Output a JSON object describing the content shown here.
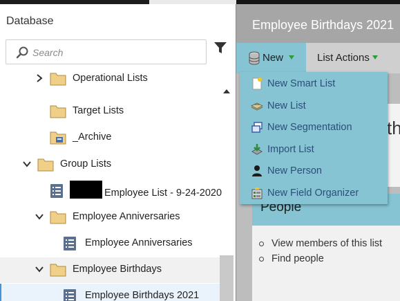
{
  "panel": {
    "title": "Database",
    "search_placeholder": "Search"
  },
  "tree": {
    "rows": [
      {
        "label": "Operational Lists",
        "icon": "folder-icon",
        "chevron": "right"
      },
      {
        "label": "Target Lists",
        "icon": "folder-icon",
        "chevron": ""
      },
      {
        "label": "_Archive",
        "icon": "archive-folder-icon",
        "chevron": ""
      },
      {
        "label": "Group Lists",
        "icon": "folder-icon",
        "chevron": "down"
      },
      {
        "label": "Employee List - 9-24-2020",
        "icon": "list-icon",
        "chevron": "",
        "redacted_prefix": true
      },
      {
        "label": "Employee Anniversaries",
        "icon": "folder-icon",
        "chevron": "down"
      },
      {
        "label": "Employee Anniversaries",
        "icon": "list-icon",
        "chevron": ""
      },
      {
        "label": "Employee Birthdays",
        "icon": "folder-icon",
        "chevron": "down",
        "highlighted": true
      },
      {
        "label": "Employee Birthdays 2021",
        "icon": "list-icon",
        "chevron": "",
        "selected": true
      }
    ]
  },
  "header": {
    "title": "Employee Birthdays 2021"
  },
  "toolbar": {
    "new_label": "New",
    "list_actions_label": "List Actions"
  },
  "menu": {
    "items": [
      {
        "label": "New Smart List",
        "icon": "smart-list-icon"
      },
      {
        "label": "New List",
        "icon": "list-stack-icon"
      },
      {
        "label": "New Segmentation",
        "icon": "segmentation-icon"
      },
      {
        "label": "Import List",
        "icon": "import-icon"
      },
      {
        "label": "New Person",
        "icon": "person-icon"
      },
      {
        "label": "New Field Organizer",
        "icon": "field-organizer-icon"
      }
    ]
  },
  "content": {
    "partial_heading": "th",
    "people_title": "People",
    "people_links": [
      "View members of this list",
      "Find people"
    ]
  },
  "colors": {
    "accent_teal": "#86c4d3",
    "menu_text": "#2c4f7a",
    "header_gray": "#a6a6a6",
    "folder_fill": "#f0d089"
  }
}
